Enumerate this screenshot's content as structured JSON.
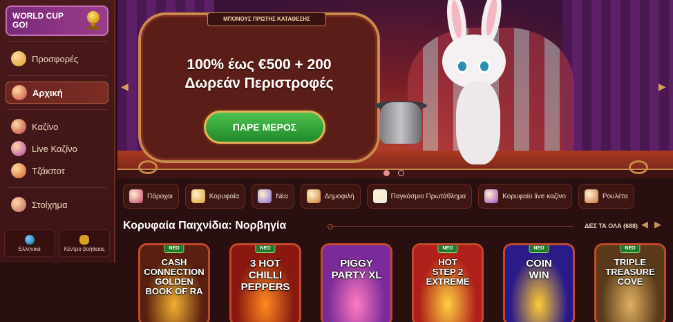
{
  "sidebar": {
    "promo": {
      "label": "WORLD CUP\nGO!"
    },
    "items": [
      {
        "label": "Προσφορές",
        "icon": "gift-star-icon",
        "active": false
      },
      {
        "label": "Αρχική",
        "icon": "circus-tent-icon",
        "active": true
      },
      {
        "label": "Καζίνο",
        "icon": "slot-reels-icon",
        "active": false
      },
      {
        "label": "Live Καζίνο",
        "icon": "live-dealer-icon",
        "active": false
      },
      {
        "label": "Τζάκποτ",
        "icon": "jackpot-wheel-icon",
        "active": false
      },
      {
        "label": "Στοίχημα",
        "icon": "sports-bet-icon",
        "active": false
      }
    ],
    "language_label": "Ελληνικά",
    "help_label": "Κέντρο βοήθειας"
  },
  "hero": {
    "tag": "ΜΠΟΝΟΥΣ ΠΡΩΤΗΣ ΚΑΤΑΘΕΣΗΣ",
    "title": "100% έως €500 + 200\nΔωρεάν Περιστροφές",
    "cta": "ΠΑΡΕ ΜΕΡΟΣ",
    "slides_total": 2,
    "slide_active": 1
  },
  "categories": [
    {
      "label": "Πάροχοι",
      "icon": "providers-icon",
      "color": "#c0446a"
    },
    {
      "label": "Κορυφαία",
      "icon": "top-star-icon",
      "color": "#d9a025"
    },
    {
      "label": "Νέα",
      "icon": "new-hat-icon",
      "color": "#8a6ad0"
    },
    {
      "label": "Δημοφιλή",
      "icon": "popular-icon",
      "color": "#d07a30"
    },
    {
      "label": "Παγκόσμιο Πρωτάθλημα",
      "icon": "football-icon",
      "color": "#e8e8e8"
    },
    {
      "label": "Κορυφαίο live καζίνο",
      "icon": "live-casino-icon",
      "color": "#a04ac0"
    },
    {
      "label": "Ρουλέτα",
      "icon": "roulette-icon",
      "color": "#c9703a"
    }
  ],
  "section": {
    "title": "Κορυφαία Παιχνίδια: Νορβηγία",
    "see_all": "ΔΕΣ ΤΑ ΟΛΑ (688)"
  },
  "games": [
    {
      "badge": "ΝΕΟ",
      "title": "CASH CONNECTION\nGOLDEN\nBOOK OF RA",
      "bg": "#5a1f10",
      "accent": "#f0b030"
    },
    {
      "badge": "ΝΕΟ",
      "title": "3 HOT CHILLI\nPEPPERS",
      "bg": "#8a1810",
      "accent": "#ff8a20"
    },
    {
      "badge": "",
      "title": "PIGGY\nPARTY XL",
      "bg": "#7a2a9a",
      "accent": "#ff7ac0"
    },
    {
      "badge": "ΝΕΟ",
      "title": "HOT\nSTEP 2\nEXTREME",
      "bg": "#b0201a",
      "accent": "#ffd040"
    },
    {
      "badge": "ΝΕΟ",
      "title": "COIN\nWIN",
      "bg": "#2a1a8a",
      "accent": "#ffcc30"
    },
    {
      "badge": "ΝΕΟ",
      "title": "TRIPLE\nTREASURE\nCOVE",
      "bg": "#5a3a1a",
      "accent": "#e0b060"
    }
  ]
}
